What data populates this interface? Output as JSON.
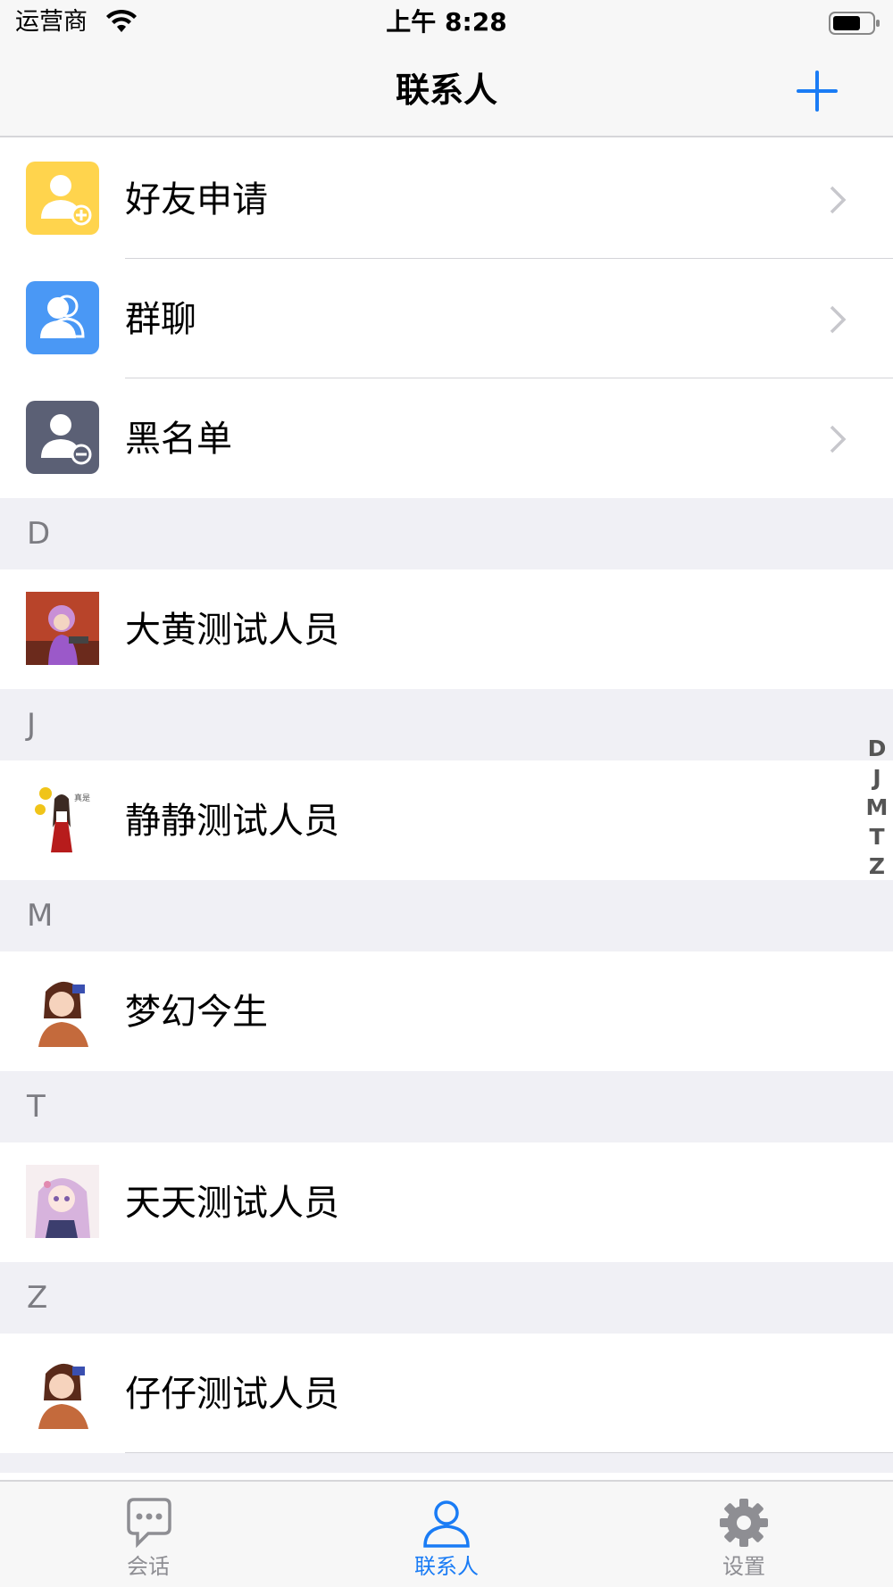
{
  "status_bar": {
    "carrier": "运营商",
    "time": "上午 8:28"
  },
  "nav": {
    "title": "联系人"
  },
  "menu_items": [
    {
      "label": "好友申请",
      "icon": "friend-request-icon",
      "color": "#ffd44d"
    },
    {
      "label": "群聊",
      "icon": "group-chat-icon",
      "color": "#4a98f5"
    },
    {
      "label": "黑名单",
      "icon": "blacklist-icon",
      "color": "#5b6075"
    }
  ],
  "sections": [
    {
      "letter": "D",
      "contacts": [
        {
          "name": "大黄测试人员"
        }
      ]
    },
    {
      "letter": "J",
      "contacts": [
        {
          "name": "静静测试人员"
        }
      ]
    },
    {
      "letter": "M",
      "contacts": [
        {
          "name": "梦幻今生"
        }
      ]
    },
    {
      "letter": "T",
      "contacts": [
        {
          "name": "天天测试人员"
        }
      ]
    },
    {
      "letter": "Z",
      "contacts": [
        {
          "name": "仔仔测试人员"
        }
      ]
    }
  ],
  "index_letters": [
    "D",
    "J",
    "M",
    "T",
    "Z"
  ],
  "tabs": [
    {
      "label": "会话",
      "icon": "chat-bubble-icon",
      "active": false
    },
    {
      "label": "联系人",
      "icon": "person-icon",
      "active": true
    },
    {
      "label": "设置",
      "icon": "gear-icon",
      "active": false
    }
  ],
  "colors": {
    "accent": "#1a7cf5",
    "inactive": "#8e8e93",
    "section_bg": "#f0f0f5"
  }
}
